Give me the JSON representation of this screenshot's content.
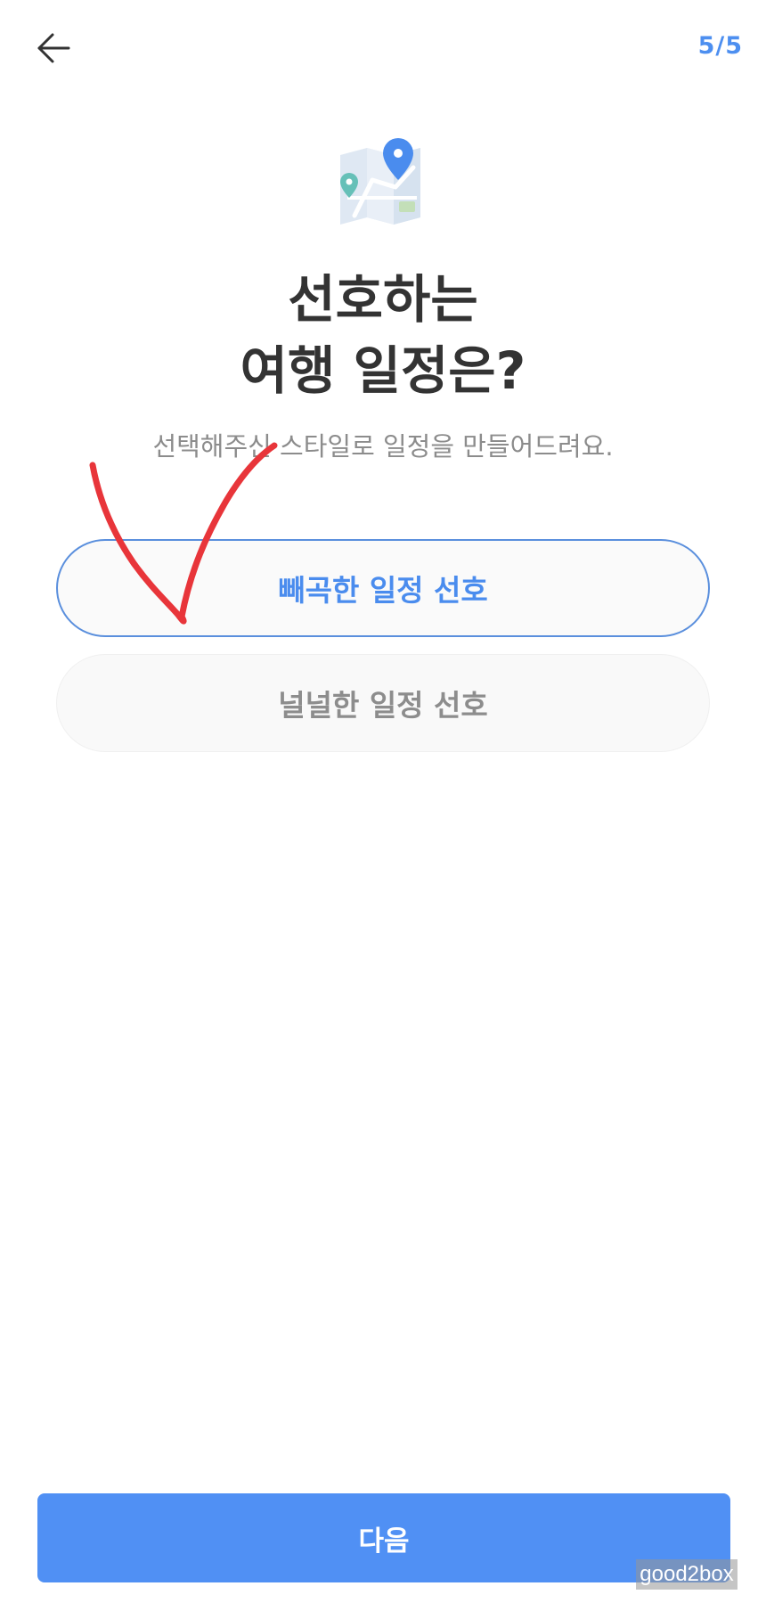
{
  "header": {
    "step_indicator": "5/5",
    "back_icon": "arrow-left-icon"
  },
  "hero": {
    "illustration_icon": "map-pins-icon",
    "title_line1": "선호하는",
    "title_line2": "여행 일정은?",
    "subtitle": "선택해주신 스타일로 일정을 만들어드려요."
  },
  "options": [
    {
      "label": "빼곡한 일정 선호",
      "selected": true
    },
    {
      "label": "널널한 일정 선호",
      "selected": false
    }
  ],
  "footer": {
    "next_label": "다음"
  },
  "watermark": "good2box",
  "colors": {
    "accent": "#5090f4",
    "selected_text": "#4a8cee",
    "annotation": "#e8353a"
  }
}
